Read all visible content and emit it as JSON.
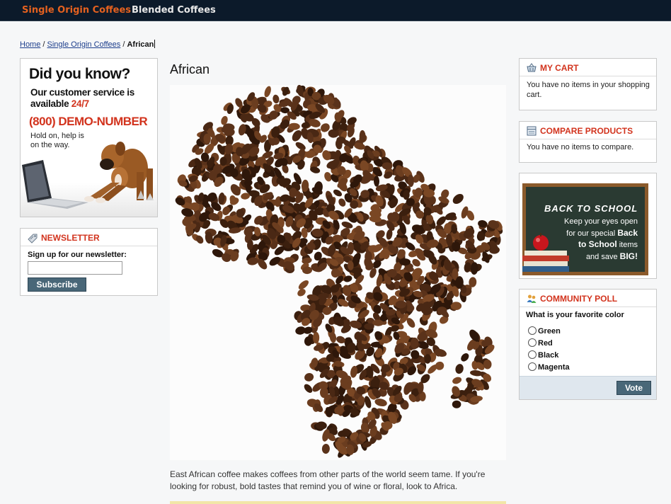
{
  "nav": {
    "items": [
      {
        "label": "Single Origin Coffees",
        "active": true
      },
      {
        "label": "Blended Coffees",
        "active": false
      }
    ],
    "colors": {
      "background": "#0c1a2a",
      "active": "#e5611f",
      "normal": "#e8e8e8"
    }
  },
  "breadcrumb": {
    "home": "Home",
    "sep1": "/",
    "category": "Single Origin Coffees",
    "sep2": "/",
    "current": "African"
  },
  "callout": {
    "did_you_know": "Did you know?",
    "service_line": "Our customer service is available",
    "service_hours": "24/7",
    "phone": "(800) DEMO-NUMBER",
    "hold_text": "Hold on, help is on the way."
  },
  "newsletter": {
    "title": "Newsletter",
    "label": "Sign up for our newsletter:",
    "input_value": "",
    "button": "Subscribe"
  },
  "main": {
    "title": "African",
    "description": "East African coffee makes coffees from other parts of the world seem tame. If you're looking for robust, bold tastes that remind you of wine or floral, look to Africa."
  },
  "cart": {
    "title": "My Cart",
    "text": "You have no items in your shopping cart."
  },
  "compare": {
    "title": "Compare Products",
    "text": "You have no items to compare."
  },
  "promo": {
    "headline": "BACK TO SCHOOL",
    "line1": "Keep your eyes open",
    "line2": "for our special",
    "highlight1": "Back",
    "highlight2": "to School",
    "line3": "items",
    "line4": "and save",
    "highlight3": "BIG!"
  },
  "poll": {
    "title": "Community Poll",
    "question": "What is your favorite color",
    "options": [
      "Green",
      "Red",
      "Black",
      "Magenta"
    ],
    "button": "Vote"
  },
  "accent": "#d2331d",
  "button_color": "#496778"
}
